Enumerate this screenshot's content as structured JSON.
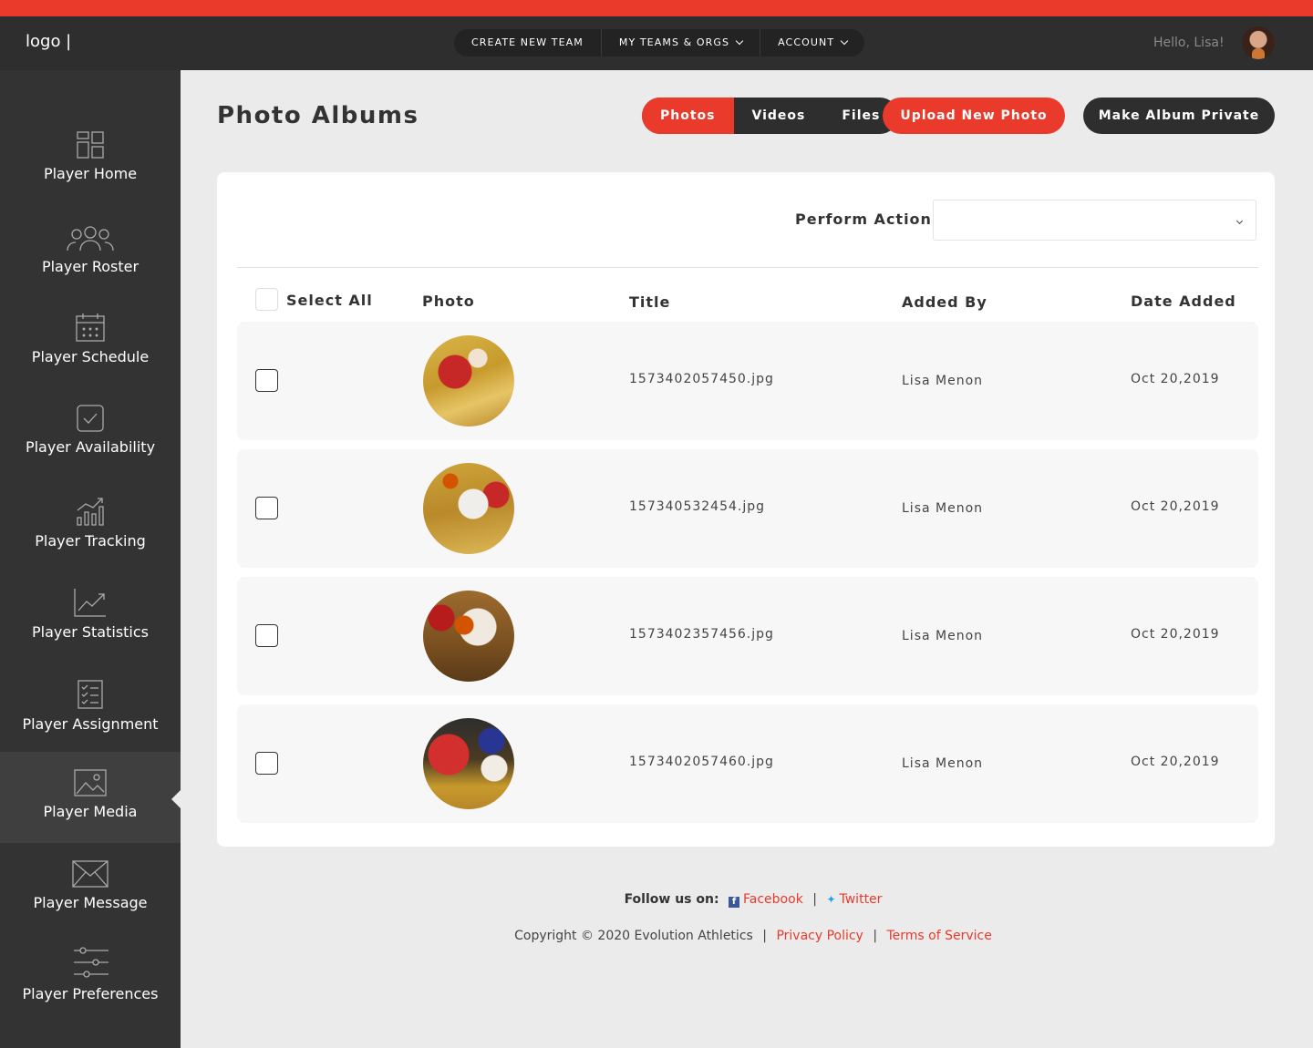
{
  "app": {
    "logo": "logo |",
    "hello": "Hello, Lisa!"
  },
  "topnav": {
    "items": [
      {
        "label": "CREATE NEW TEAM"
      },
      {
        "label": "MY TEAMS & ORGS"
      },
      {
        "label": "ACCOUNT"
      }
    ]
  },
  "sidebar": {
    "items": [
      {
        "label": "Player Home",
        "icon": "dashboard-icon"
      },
      {
        "label": "Player Roster",
        "icon": "group-icon"
      },
      {
        "label": "Player Schedule",
        "icon": "calendar-icon"
      },
      {
        "label": "Player Availability",
        "icon": "checkbox-icon"
      },
      {
        "label": "Player Tracking",
        "icon": "bar-chart-icon"
      },
      {
        "label": "Player Statistics",
        "icon": "line-chart-icon"
      },
      {
        "label": "Player Assignment",
        "icon": "checklist-icon"
      },
      {
        "label": "Player Media",
        "icon": "image-icon",
        "active": true
      },
      {
        "label": "Player Message",
        "icon": "envelope-icon"
      },
      {
        "label": "Player Preferences",
        "icon": "sliders-icon"
      }
    ]
  },
  "header": {
    "title": "Photo Albums",
    "tabs": [
      {
        "label": "Photos",
        "active": true
      },
      {
        "label": "Videos"
      },
      {
        "label": "Files"
      }
    ],
    "upload_label": "Upload New Photo",
    "private_label": "Make Album Private"
  },
  "table": {
    "perform_action_label": "Perform Action:",
    "perform_action_value": "",
    "select_all_label": "Select All",
    "columns": {
      "photo": "Photo",
      "title": "Title",
      "added_by": "Added By",
      "date_added": "Date Added"
    },
    "rows": [
      {
        "title": "1573402057450.jpg",
        "added_by": "Lisa Menon",
        "date_added": "Oct 20,2019"
      },
      {
        "title": "157340532454.jpg",
        "added_by": "Lisa Menon",
        "date_added": "Oct 20,2019"
      },
      {
        "title": "1573402357456.jpg",
        "added_by": "Lisa Menon",
        "date_added": "Oct 20,2019"
      },
      {
        "title": "1573402057460.jpg",
        "added_by": "Lisa Menon",
        "date_added": "Oct 20,2019"
      }
    ]
  },
  "footer": {
    "follow_label": "Follow us on:",
    "facebook": "Facebook",
    "twitter": "Twitter",
    "copyright": "Copyright © 2020 Evolution Athletics",
    "privacy": "Privacy Policy",
    "terms": "Terms of Service",
    "separator": "|"
  },
  "colors": {
    "accent": "#ea3a2b",
    "dark": "#2e2e2e",
    "sidebar": "#333333",
    "background": "#ebebeb"
  }
}
